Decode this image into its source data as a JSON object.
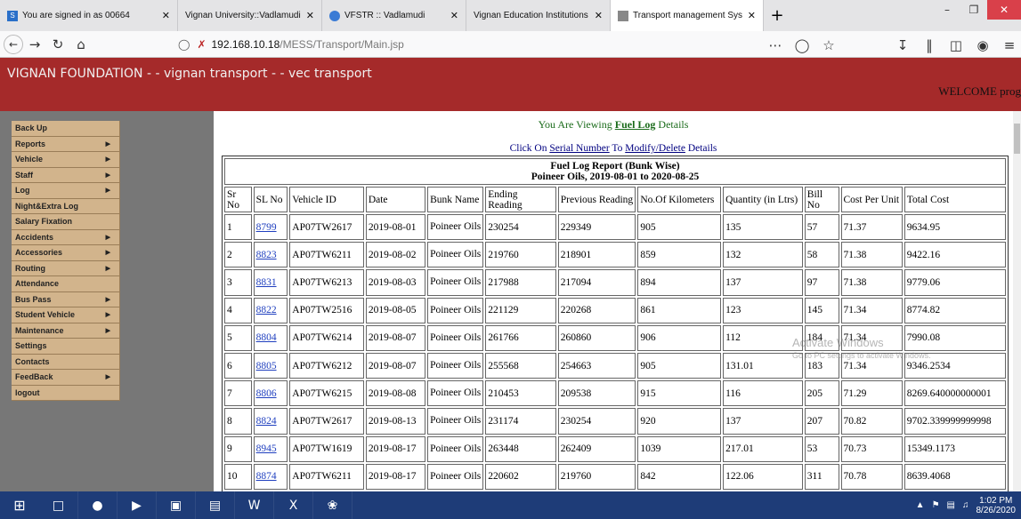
{
  "browser": {
    "tabs": [
      {
        "label": "You are signed in as 00664",
        "icon": "vignan-s-icon"
      },
      {
        "label": "Vignan University::Vadlamudi, Gunt",
        "icon": "none"
      },
      {
        "label": "VFSTR :: Vadlamudi",
        "icon": "vfstr-icon"
      },
      {
        "label": "Vignan Education Institutions",
        "icon": "none"
      },
      {
        "label": "Transport management System",
        "icon": "page-icon"
      }
    ],
    "url_host": "192.168.10.18",
    "url_path": "/MESS/Transport/Main.jsp"
  },
  "header": {
    "title": "VIGNAN FOUNDATION - - vignan transport - - vec transport",
    "welcome": "WELCOME prog"
  },
  "sidebar": {
    "items": [
      {
        "label": "Back Up",
        "submenu": false
      },
      {
        "label": "Reports",
        "submenu": true
      },
      {
        "label": "Vehicle",
        "submenu": true
      },
      {
        "label": "Staff",
        "submenu": true
      },
      {
        "label": "Log",
        "submenu": true
      },
      {
        "label": "Night&Extra Log",
        "submenu": false
      },
      {
        "label": "Salary Fixation",
        "submenu": false
      },
      {
        "label": "Accidents",
        "submenu": true
      },
      {
        "label": "Accessories",
        "submenu": true
      },
      {
        "label": "Routing",
        "submenu": true
      },
      {
        "label": "Attendance",
        "submenu": false
      },
      {
        "label": "Bus Pass",
        "submenu": true
      },
      {
        "label": "Student Vehicle",
        "submenu": true
      },
      {
        "label": "Maintenance",
        "submenu": true
      },
      {
        "label": "Settings",
        "submenu": false
      },
      {
        "label": "Contacts",
        "submenu": false
      },
      {
        "label": "FeedBack",
        "submenu": true
      },
      {
        "label": "logout",
        "submenu": false
      }
    ]
  },
  "main": {
    "viewing_prefix": "You Are Viewing ",
    "viewing_link": "Fuel Log",
    "viewing_suffix": " Details",
    "click_prefix": "Click On ",
    "click_link1": "Serial Number",
    "click_mid": " To ",
    "click_link2": "Modify/Delete",
    "click_suffix": " Details",
    "report_title": "Fuel Log Report (Bunk Wise)",
    "report_subtitle": "Poineer Oils, 2019-08-01 to 2020-08-25",
    "columns": [
      "Sr No",
      "SL No",
      "Vehicle ID",
      "Date",
      "Bunk Name",
      "Ending Reading",
      "Previous Reading",
      "No.Of Kilometers",
      "Quantity (in Ltrs)",
      "Bill No",
      "Cost Per Unit",
      "Total Cost"
    ],
    "rows": [
      [
        "1",
        "8799",
        "AP07TW2617",
        "2019-08-01",
        "Poineer Oils",
        "230254",
        "229349",
        "905",
        "135",
        "57",
        "71.37",
        "9634.95"
      ],
      [
        "2",
        "8823",
        "AP07TW6211",
        "2019-08-02",
        "Poineer Oils",
        "219760",
        "218901",
        "859",
        "132",
        "58",
        "71.38",
        "9422.16"
      ],
      [
        "3",
        "8831",
        "AP07TW6213",
        "2019-08-03",
        "Poineer Oils",
        "217988",
        "217094",
        "894",
        "137",
        "97",
        "71.38",
        "9779.06"
      ],
      [
        "4",
        "8822",
        "AP07TW2516",
        "2019-08-05",
        "Poineer Oils",
        "221129",
        "220268",
        "861",
        "123",
        "145",
        "71.34",
        "8774.82"
      ],
      [
        "5",
        "8804",
        "AP07TW6214",
        "2019-08-07",
        "Poineer Oils",
        "261766",
        "260860",
        "906",
        "112",
        "184",
        "71.34",
        "7990.08"
      ],
      [
        "6",
        "8805",
        "AP07TW6212",
        "2019-08-07",
        "Poineer Oils",
        "255568",
        "254663",
        "905",
        "131.01",
        "183",
        "71.34",
        "9346.2534"
      ],
      [
        "7",
        "8806",
        "AP07TW6215",
        "2019-08-08",
        "Poineer Oils",
        "210453",
        "209538",
        "915",
        "116",
        "205",
        "71.29",
        "8269.640000000001"
      ],
      [
        "8",
        "8824",
        "AP07TW2617",
        "2019-08-13",
        "Poineer Oils",
        "231174",
        "230254",
        "920",
        "137",
        "207",
        "70.82",
        "9702.339999999998"
      ],
      [
        "9",
        "8945",
        "AP07TW1619",
        "2019-08-17",
        "Poineer Oils",
        "263448",
        "262409",
        "1039",
        "217.01",
        "53",
        "70.73",
        "15349.1173"
      ],
      [
        "10",
        "8874",
        "AP07TW6211",
        "2019-08-17",
        "Poineer Oils",
        "220602",
        "219760",
        "842",
        "122.06",
        "311",
        "70.78",
        "8639.4068"
      ]
    ]
  },
  "watermark": {
    "line1": "Activate Windows",
    "line2": "Go to PC settings to activate Windows."
  },
  "taskbar": {
    "time": "1:02 PM",
    "date": "8/26/2020"
  },
  "colors": {
    "banner": "#a52a2a",
    "sidebar_bg": "#777777",
    "menu_item": "#d2b48c",
    "link_green": "#1a6b1a",
    "taskbar": "#1e3c78"
  }
}
